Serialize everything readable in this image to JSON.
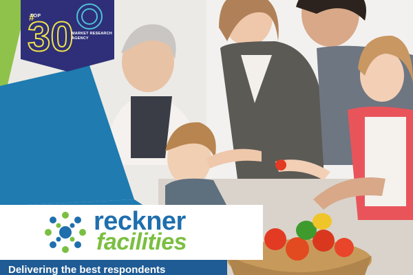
{
  "badge": {
    "top_label": "TOP",
    "rank": "30",
    "title": "MARKET RESEARCH AGENCY"
  },
  "brand": {
    "name_line1": "reckner",
    "name_line2": "facilities",
    "colors": {
      "blue": "#1f6fad",
      "green": "#7bbf42",
      "navy": "#2e2f78",
      "yellow": "#f0e24a"
    }
  },
  "footer": {
    "tagline": "Delivering the best respondents"
  },
  "photo": {
    "icon": "family-cooking-photo"
  }
}
